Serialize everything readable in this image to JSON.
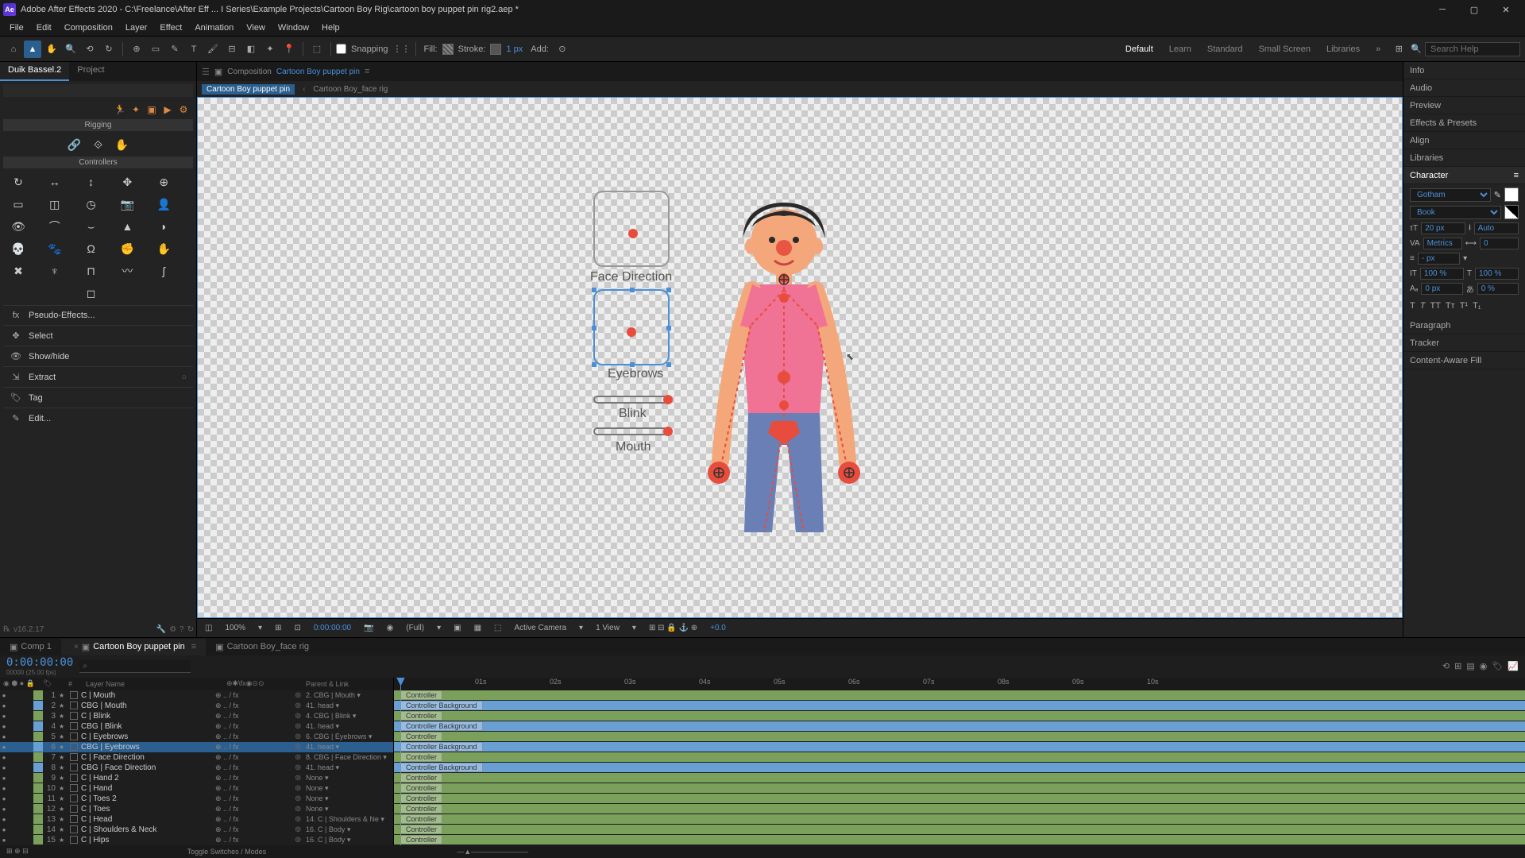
{
  "title": "Adobe After Effects 2020 - C:\\Freelance\\After Eff ... I Series\\Example Projects\\Cartoon Boy Rig\\cartoon boy puppet pin rig2.aep *",
  "menus": [
    "File",
    "Edit",
    "Composition",
    "Layer",
    "Effect",
    "Animation",
    "View",
    "Window",
    "Help"
  ],
  "toolbar": {
    "snapping": "Snapping",
    "fill": "Fill:",
    "stroke": "Stroke:",
    "stroke_px": "1 px",
    "add": "Add:"
  },
  "workspaces": [
    "Default",
    "Learn",
    "Standard",
    "Small Screen",
    "Libraries"
  ],
  "search_placeholder": "Search Help",
  "left_tabs": {
    "a": "Duik Bassel.2",
    "b": "Project"
  },
  "duik": {
    "rigging": "Rigging",
    "controllers": "Controllers",
    "pseudo": "Pseudo-Effects...",
    "select": "Select",
    "showhide": "Show/hide",
    "extract": "Extract",
    "tag": "Tag",
    "edit": "Edit...",
    "version": "v16.2.17"
  },
  "comp": {
    "panel_label": "Composition",
    "name": "Cartoon Boy puppet pin",
    "crumb1": "Cartoon Boy puppet pin",
    "crumb2": "Cartoon Boy_face rig"
  },
  "viewport_labels": {
    "face": "Face Direction",
    "eyebrows": "Eyebrows",
    "blink": "Blink",
    "mouth": "Mouth"
  },
  "comp_footer": {
    "zoom": "100%",
    "res": "(Full)",
    "camera": "Active Camera",
    "view": "1 View",
    "exp": "+0.0",
    "time": "0:00:00:00"
  },
  "right_items": [
    "Info",
    "Audio",
    "Preview",
    "Effects & Presets",
    "Align",
    "Libraries",
    "Character"
  ],
  "character": {
    "font": "Gotham",
    "style": "Book",
    "size": "20 px",
    "leading": "Auto",
    "kerning": "Metrics",
    "tracking": "0",
    "vscale": "100 %",
    "hscale": "100 %",
    "baseline": "0 px",
    "tsume": "0 %"
  },
  "right_items2": [
    "Paragraph",
    "Tracker",
    "Content-Aware Fill"
  ],
  "timeline": {
    "tabs": [
      "Comp 1",
      "Cartoon Boy puppet pin",
      "Cartoon Boy_face rig"
    ],
    "timecode": "0:00:00:00",
    "toggle": "Toggle Switches / Modes",
    "col_num": "#",
    "col_name": "Layer Name",
    "col_parent": "Parent & Link",
    "seconds": [
      "01s",
      "02s",
      "03s",
      "04s",
      "05s",
      "06s",
      "07s",
      "08s",
      "09s",
      "10s"
    ]
  },
  "layers": [
    {
      "n": 1,
      "color": "#7aa05c",
      "name": "C | Mouth",
      "parent": "2. CBG | Mouth",
      "tag": "Controller",
      "bar": "green"
    },
    {
      "n": 2,
      "color": "#6a9fd4",
      "name": "CBG | Mouth",
      "parent": "41. head",
      "tag": "Controller Background",
      "bar": "blue"
    },
    {
      "n": 3,
      "color": "#7aa05c",
      "name": "C | Blink",
      "parent": "4. CBG | Blink",
      "tag": "Controller",
      "bar": "green"
    },
    {
      "n": 4,
      "color": "#6a9fd4",
      "name": "CBG | Blink",
      "parent": "41. head",
      "tag": "Controller Background",
      "bar": "blue"
    },
    {
      "n": 5,
      "color": "#7aa05c",
      "name": "C | Eyebrows",
      "parent": "6. CBG | Eyebrows",
      "tag": "Controller",
      "bar": "green"
    },
    {
      "n": 6,
      "color": "#6a9fd4",
      "name": "CBG | Eyebrows",
      "parent": "41. head",
      "tag": "Controller Background",
      "bar": "blue",
      "sel": true
    },
    {
      "n": 7,
      "color": "#7aa05c",
      "name": "C | Face Direction",
      "parent": "8. CBG | Face Direction",
      "tag": "Controller",
      "bar": "green"
    },
    {
      "n": 8,
      "color": "#6a9fd4",
      "name": "CBG | Face Direction",
      "parent": "41. head",
      "tag": "Controller Background",
      "bar": "blue"
    },
    {
      "n": 9,
      "color": "#7aa05c",
      "name": "C | Hand 2",
      "parent": "None",
      "tag": "Controller",
      "bar": "green"
    },
    {
      "n": 10,
      "color": "#7aa05c",
      "name": "C | Hand",
      "parent": "None",
      "tag": "Controller",
      "bar": "green"
    },
    {
      "n": 11,
      "color": "#7aa05c",
      "name": "C | Toes 2",
      "parent": "None",
      "tag": "Controller",
      "bar": "green"
    },
    {
      "n": 12,
      "color": "#7aa05c",
      "name": "C | Toes",
      "parent": "None",
      "tag": "Controller",
      "bar": "green"
    },
    {
      "n": 13,
      "color": "#7aa05c",
      "name": "C | Head",
      "parent": "14. C | Shoulders & Ne",
      "tag": "Controller",
      "bar": "green"
    },
    {
      "n": 14,
      "color": "#7aa05c",
      "name": "C | Shoulders & Neck",
      "parent": "16. C | Body",
      "tag": "Controller",
      "bar": "green"
    },
    {
      "n": 15,
      "color": "#7aa05c",
      "name": "C | Hips",
      "parent": "16. C | Body",
      "tag": "Controller",
      "bar": "green"
    }
  ]
}
